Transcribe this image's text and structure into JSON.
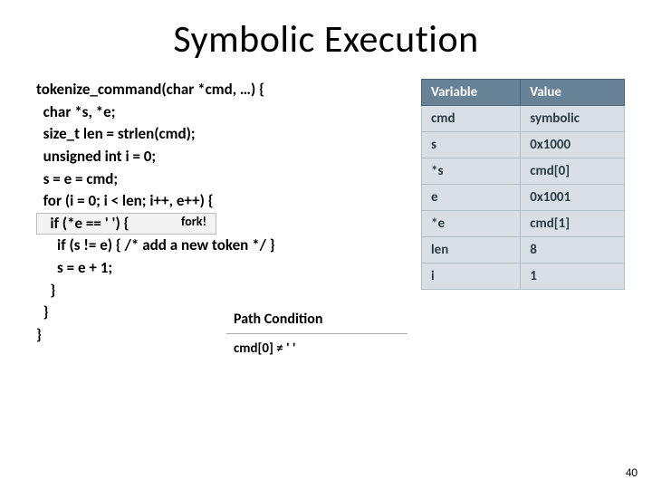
{
  "title": "Symbolic Execution",
  "code": {
    "l0": "tokenize_command(char *cmd, …) {",
    "l1": "  char *s, *e;",
    "l2": "  size_t len = strlen(cmd);",
    "l3": "  unsigned int i = 0;",
    "l4": "  s = e = cmd;",
    "l5": "  for (i = 0; i < len; i++, e++) {",
    "l6": "    if (*e == ' ') {                         ",
    "fork_label": "fork!",
    "l7": "      if (s != e) { /* add a new token */ }",
    "l8": "      s = e + 1;",
    "l9": "    }",
    "l10": "  }",
    "l11": "}"
  },
  "state_headers": {
    "var": "Variable",
    "val": "Value"
  },
  "state_rows": [
    {
      "var": "cmd",
      "val": "symbolic"
    },
    {
      "var": "s",
      "val": "0x1000"
    },
    {
      "var": "*s",
      "val": "cmd[0]"
    },
    {
      "var": "e",
      "val": "0x1001"
    },
    {
      "var": "*e",
      "val": "cmd[1]"
    },
    {
      "var": "len",
      "val": "8"
    },
    {
      "var": "i",
      "val": "1"
    }
  ],
  "pc": {
    "header": "Path Condition",
    "body": "cmd[0] ≠ ' '"
  },
  "pagenum": "40"
}
